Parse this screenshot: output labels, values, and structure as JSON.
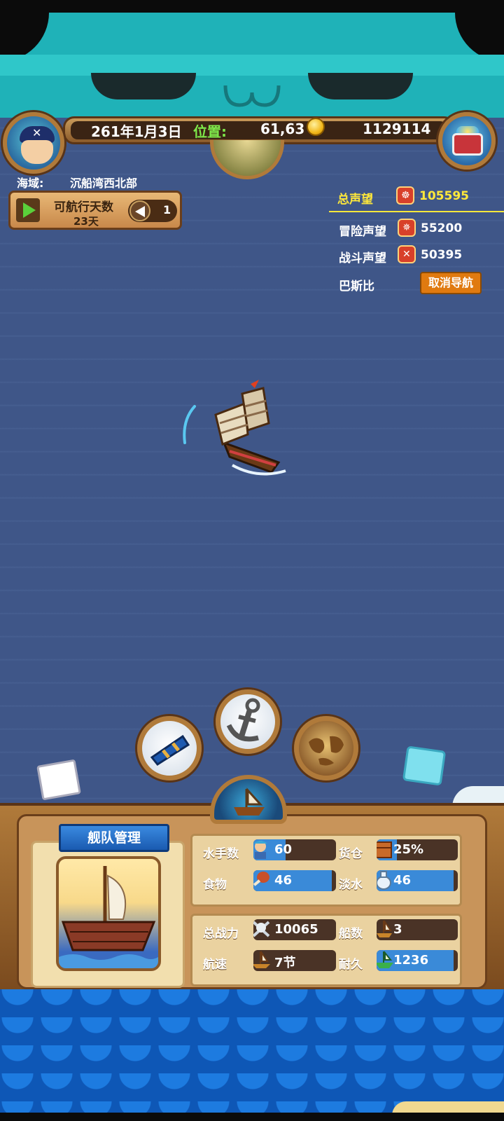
{
  "header": {
    "date": "261年1月3日",
    "position_label": "位置:",
    "position_value": "61,63",
    "gold": "1129114"
  },
  "sea_area": {
    "label": "海域:",
    "value": "沉船湾西北部"
  },
  "voyage": {
    "days_title": "可航行天数",
    "days_value": "23天",
    "speed_value": "1"
  },
  "reputation": {
    "total_label": "总声望",
    "total_value": "105595",
    "adventure_label": "冒险声望",
    "adventure_value": "55200",
    "battle_label": "战斗声望",
    "battle_value": "50395"
  },
  "navigation": {
    "port_name": "巴斯比",
    "cancel_label": "取消导航"
  },
  "fleet": {
    "title": "舰队管理",
    "stats": {
      "sailors_label": "水手数",
      "sailors_value": "60",
      "cargo_label": "货仓",
      "cargo_value": "25%",
      "cargo_fill": 0.25,
      "food_label": "食物",
      "food_value": "46",
      "water_label": "淡水",
      "water_value": "46",
      "power_label": "总战力",
      "power_value": "10065",
      "ships_label": "船数",
      "ships_value": "3",
      "speed_label": "航速",
      "speed_value": "7节",
      "durability_label": "耐久",
      "durability_value": "1236"
    }
  },
  "icons": {
    "avatar": "pirate-avatar-icon",
    "chest": "treasure-chest-icon",
    "globe": "globe-icon",
    "coin": "gold-coin-icon",
    "telescope": "telescope-icon",
    "anchor": "anchor-icon",
    "map": "world-map-icon",
    "helm": "ship-helm-icon"
  },
  "colors": {
    "sea": "#3f5688",
    "highlight_yellow": "#ffe83a",
    "cancel_button": "#e07a10",
    "bar_fill": "#3a8ad8"
  }
}
